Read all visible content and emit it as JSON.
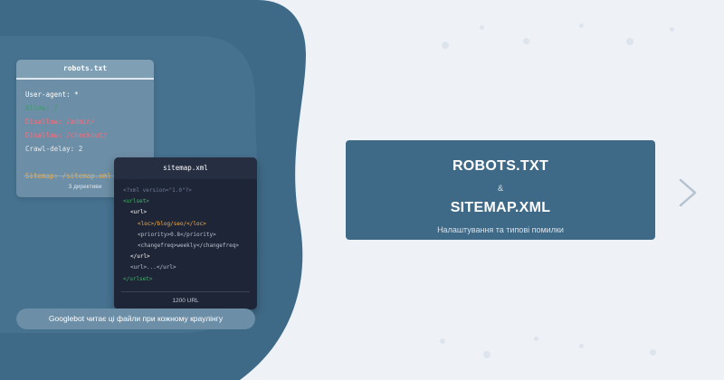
{
  "robots": {
    "title": "robots.txt",
    "lines": [
      {
        "text": "User-agent: *",
        "color": "#ffffff"
      },
      {
        "text": "Allow: /",
        "color": "#3f9d6b"
      },
      {
        "text": "Disallow: /admin/",
        "color": "#ff6b7a"
      },
      {
        "text": "Disallow: /checkout/",
        "color": "#ff6b7a"
      },
      {
        "text": "Crawl-delay: 2",
        "color": "#e6edf2"
      },
      {
        "text": "",
        "color": "#ffffff"
      },
      {
        "text": "Sitemap: /sitemap.xml",
        "color": "#f5b046"
      }
    ],
    "footer": "3 директиви"
  },
  "sitemap": {
    "title": "sitemap.xml",
    "lines": [
      {
        "text": "<?xml version=\"1.0\"?>",
        "color": "#6f7a93",
        "indent": 0
      },
      {
        "text": "<urlset>",
        "color": "#4caf6e",
        "indent": 0
      },
      {
        "text": "<url>",
        "color": "#ffffff",
        "indent": 1
      },
      {
        "text": "<loc>/blog/seo/</loc>",
        "color": "#f5b046",
        "indent": 2
      },
      {
        "text": "<priority>0.8</priority>",
        "color": "#b8c0cc",
        "indent": 2
      },
      {
        "text": "<changefreq>weekly</changefreq>",
        "color": "#b8c0cc",
        "indent": 2
      },
      {
        "text": "</url>",
        "color": "#ffffff",
        "indent": 1
      },
      {
        "text": "<url>...</url>",
        "color": "#b8c0cc",
        "indent": 1
      },
      {
        "text": "</urlset>",
        "color": "#4caf6e",
        "indent": 0
      }
    ],
    "footer": "1200 URL"
  },
  "caption": "Googlebot читає ці файли при кожному краулінгу",
  "title": {
    "line1": "ROBOTS.TXT",
    "amp": "&",
    "line2": "SITEMAP.XML",
    "subtitle": "Налаштування та типові помилки"
  },
  "next_icon": "chevron-right-icon",
  "colors": {
    "background": "#eef2f7",
    "blob": "#3f6a87",
    "title_box": "#3f6a87",
    "card_light": "#6c8ea6",
    "card_dark": "#1e2537"
  }
}
